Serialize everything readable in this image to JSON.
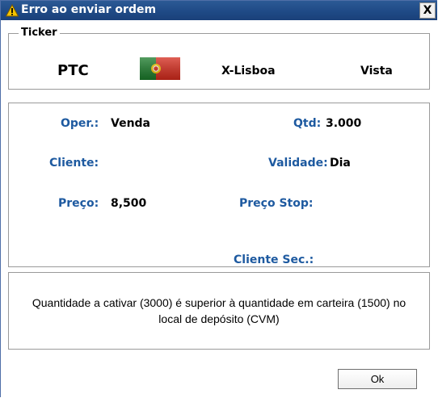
{
  "window": {
    "title": "Erro ao enviar ordem",
    "close_label": "X"
  },
  "ticker": {
    "legend": "Ticker",
    "symbol": "PTC",
    "flag_icon": "portugal-flag-icon",
    "exchange": "X-Lisboa",
    "settlement": "Vista"
  },
  "details": {
    "oper_label": "Oper.:",
    "oper_value": "Venda",
    "qtd_label": "Qtd:",
    "qtd_value": "3.000",
    "cliente_label": "Cliente:",
    "cliente_value": "",
    "validade_label": "Validade:",
    "validade_value": "Dia",
    "preco_label": "Preço:",
    "preco_value": "8,500",
    "preco_stop_label": "Preço Stop:",
    "preco_stop_value": "",
    "cliente_sec_label": "Cliente Sec.:",
    "cliente_sec_value": ""
  },
  "message": {
    "text": "Quantidade a cativar (3000) é superior à quantidade em carteira (1500) no local de depósito (CVM)"
  },
  "buttons": {
    "ok_label": "Ok"
  },
  "colors": {
    "titlebar": "#1f4a86",
    "label_blue": "#1e5aa0",
    "warning_yellow": "#f5c400"
  }
}
